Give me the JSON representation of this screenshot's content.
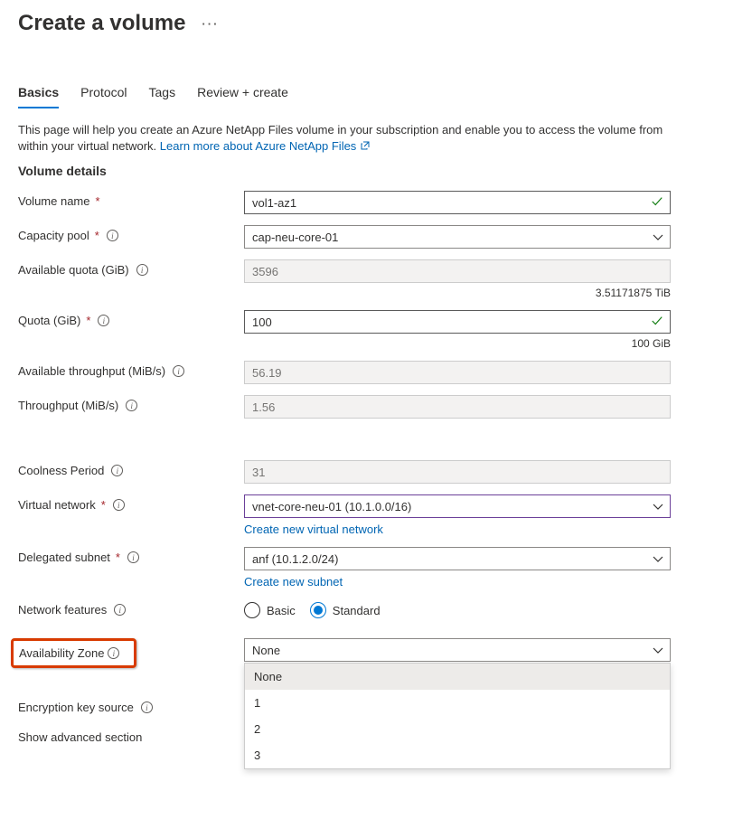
{
  "title": "Create a volume",
  "tabs": [
    "Basics",
    "Protocol",
    "Tags",
    "Review + create"
  ],
  "activeTab": 0,
  "intro": {
    "text": "This page will help you create an Azure NetApp Files volume in your subscription and enable you to access the volume from within your virtual network.",
    "linkText": "Learn more about Azure NetApp Files"
  },
  "section": "Volume details",
  "fields": {
    "volumeName": {
      "label": "Volume name",
      "value": "vol1-az1"
    },
    "capacityPool": {
      "label": "Capacity pool",
      "value": "cap-neu-core-01"
    },
    "availableQuota": {
      "label": "Available quota (GiB)",
      "value": "3596",
      "helper": "3.51171875 TiB"
    },
    "quota": {
      "label": "Quota (GiB)",
      "value": "100",
      "helper": "100 GiB"
    },
    "availableThroughput": {
      "label": "Available throughput (MiB/s)",
      "value": "56.19"
    },
    "throughput": {
      "label": "Throughput (MiB/s)",
      "value": "1.56"
    },
    "coolness": {
      "label": "Coolness Period",
      "value": "31"
    },
    "vnet": {
      "label": "Virtual network",
      "value": "vnet-core-neu-01 (10.1.0.0/16)",
      "link": "Create new virtual network"
    },
    "subnet": {
      "label": "Delegated subnet",
      "value": "anf (10.1.2.0/24)",
      "link": "Create new subnet"
    },
    "netFeatures": {
      "label": "Network features",
      "options": [
        "Basic",
        "Standard"
      ],
      "selected": 1
    },
    "az": {
      "label": "Availability Zone",
      "value": "None",
      "options": [
        "None",
        "1",
        "2",
        "3"
      ]
    },
    "encryption": {
      "label": "Encryption key source"
    },
    "advanced": {
      "label": "Show advanced section"
    }
  }
}
